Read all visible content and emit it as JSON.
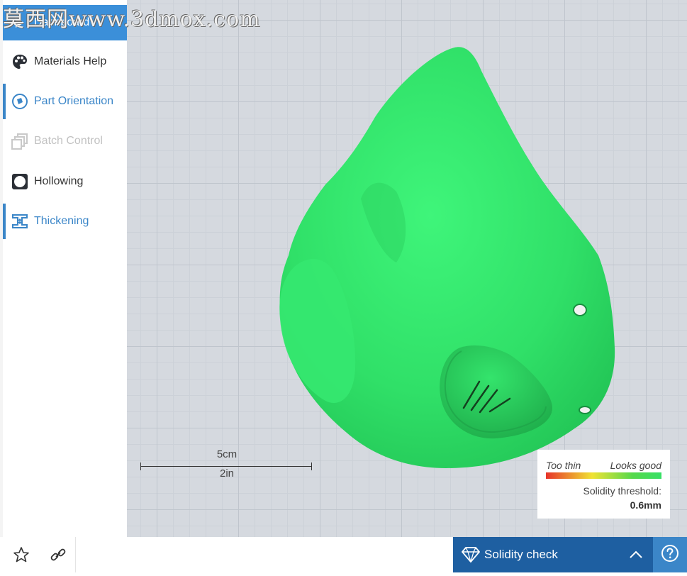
{
  "sidebar": {
    "items": [
      {
        "label": "Dashboard",
        "icon": "dashboard-icon"
      },
      {
        "label": "Materials Help",
        "icon": "palette-icon"
      },
      {
        "label": "Part Orientation",
        "icon": "orientation-icon"
      },
      {
        "label": "Batch Control",
        "icon": "batch-icon"
      },
      {
        "label": "Hollowing",
        "icon": "hollowing-icon"
      },
      {
        "label": "Thickening",
        "icon": "thickening-icon"
      }
    ]
  },
  "viewport": {
    "scale": {
      "metric": "5cm",
      "imperial": "2in"
    },
    "model_color": "#37e066"
  },
  "legend": {
    "low_label": "Too thin",
    "high_label": "Looks good",
    "threshold_label": "Solidity threshold:",
    "threshold_value": "0.6mm"
  },
  "bottom_bar": {
    "star_icon": "star-icon",
    "link_icon": "link-icon",
    "solidity_label": "Solidity check",
    "accent": "#1e5fa1",
    "help_color": "#3b86c8"
  },
  "watermark": "莫西网www.3dmox.com"
}
